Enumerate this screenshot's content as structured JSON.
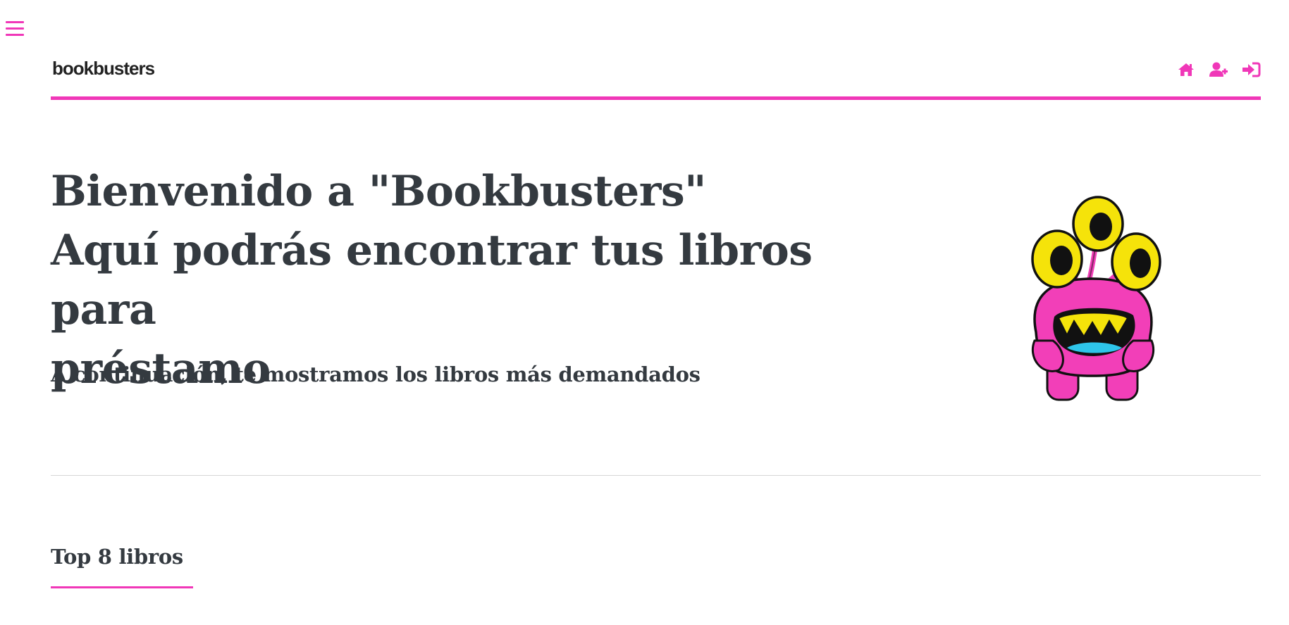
{
  "menu": {
    "icon": "hamburger-menu-icon"
  },
  "navbar": {
    "brand": "bookbusters",
    "icons": [
      "home-icon",
      "user-plus-icon",
      "sign-in-icon"
    ]
  },
  "hero": {
    "title_line1": "Bienvenido a \"Bookbusters\"",
    "title_line2": "Aquí podrás encontrar tus libros para",
    "title_line3": "préstamo",
    "subtitle": "A continuación, te mostramos los libros más demandados"
  },
  "section": {
    "title": "Top 8 libros"
  },
  "colors": {
    "accent": "#f037b8",
    "text": "#343a40",
    "mascot_body": "#f23fb8",
    "mascot_eyes": "#f5e30a",
    "mascot_tongue": "#2ec5ea"
  }
}
